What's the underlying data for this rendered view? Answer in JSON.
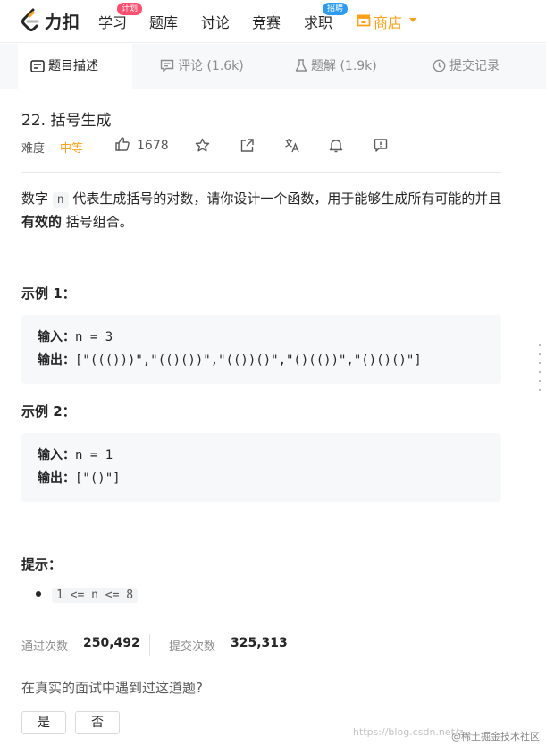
{
  "nav": {
    "brand": "力扣",
    "items": [
      {
        "label": "学习",
        "badge": "计划"
      },
      {
        "label": "题库"
      },
      {
        "label": "讨论"
      },
      {
        "label": "竞赛"
      },
      {
        "label": "求职",
        "badge": "招聘"
      }
    ],
    "shop_label": "商店"
  },
  "tabs": [
    {
      "label": "题目描述",
      "active": true
    },
    {
      "label": "评论 (1.6k)"
    },
    {
      "label": "题解 (1.9k)"
    },
    {
      "label": "提交记录"
    }
  ],
  "problem": {
    "title": "22. 括号生成",
    "difficulty_label": "难度",
    "difficulty": "中等",
    "likes": "1678",
    "description_1": "数字 ",
    "description_code": "n",
    "description_2": " 代表生成括号的对数，请你设计一个函数，用于能够生成所有可能的并且 ",
    "description_bold": "有效的",
    "description_3": " 括号组合。"
  },
  "examples": [
    {
      "title": "示例 1：",
      "input_label": "输入：",
      "input": "n = 3",
      "output_label": "输出：",
      "output": "[\"((()))\",\"(()())\",\"(())()\",\"()(())\",\"()()()\"]"
    },
    {
      "title": "示例 2：",
      "input_label": "输入：",
      "input": "n = 1",
      "output_label": "输出：",
      "output": "[\"()\"]"
    }
  ],
  "hints": {
    "title": "提示：",
    "items": [
      "1 <= n <= 8"
    ]
  },
  "stats": {
    "accepted_label": "通过次数",
    "accepted": "250,492",
    "submissions_label": "提交次数",
    "submissions": "325,313"
  },
  "feedback": {
    "question": "在真实的面试中遇到过这道题?",
    "yes": "是",
    "no": "否"
  },
  "watermark": {
    "url": "https://blog.csdn.net/z...",
    "site": "@稀土掘金技术社区"
  },
  "colors": {
    "accent": "#ffa116",
    "badge_pink": "#ff4d6d",
    "badge_blue": "#2b9cf2"
  }
}
